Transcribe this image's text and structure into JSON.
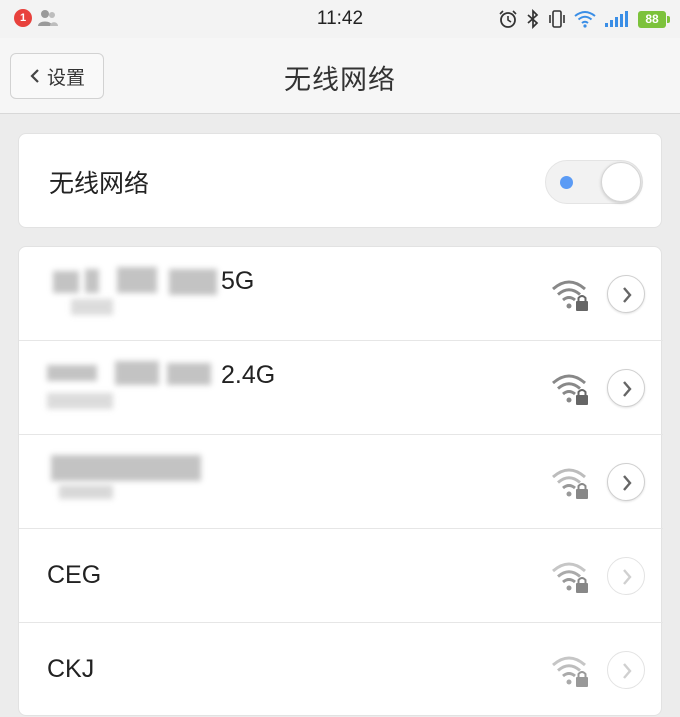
{
  "status_bar": {
    "notification_count": "1",
    "time": "11:42",
    "battery": "88",
    "icons": [
      "person-icon",
      "alarm-icon",
      "bluetooth-icon",
      "vibrate-icon",
      "wifi-icon",
      "signal-icon"
    ]
  },
  "nav": {
    "back_label": "设置",
    "title": "无线网络"
  },
  "wifi_toggle": {
    "label": "无线网络",
    "state": "on"
  },
  "networks": [
    {
      "ssid_suffix": "5G",
      "secured": true
    },
    {
      "ssid_suffix": "2.4G",
      "secured": true
    },
    {
      "ssid_suffix": "",
      "secured": true
    },
    {
      "ssid": "CEG",
      "secured": true
    },
    {
      "ssid": "CKJ",
      "secured": true
    }
  ],
  "colors": {
    "accent_blue": "#5b9bf5",
    "badge_red": "#e8413c",
    "battery_green": "#7cc23b",
    "signal_blue": "#3a8ee6"
  }
}
